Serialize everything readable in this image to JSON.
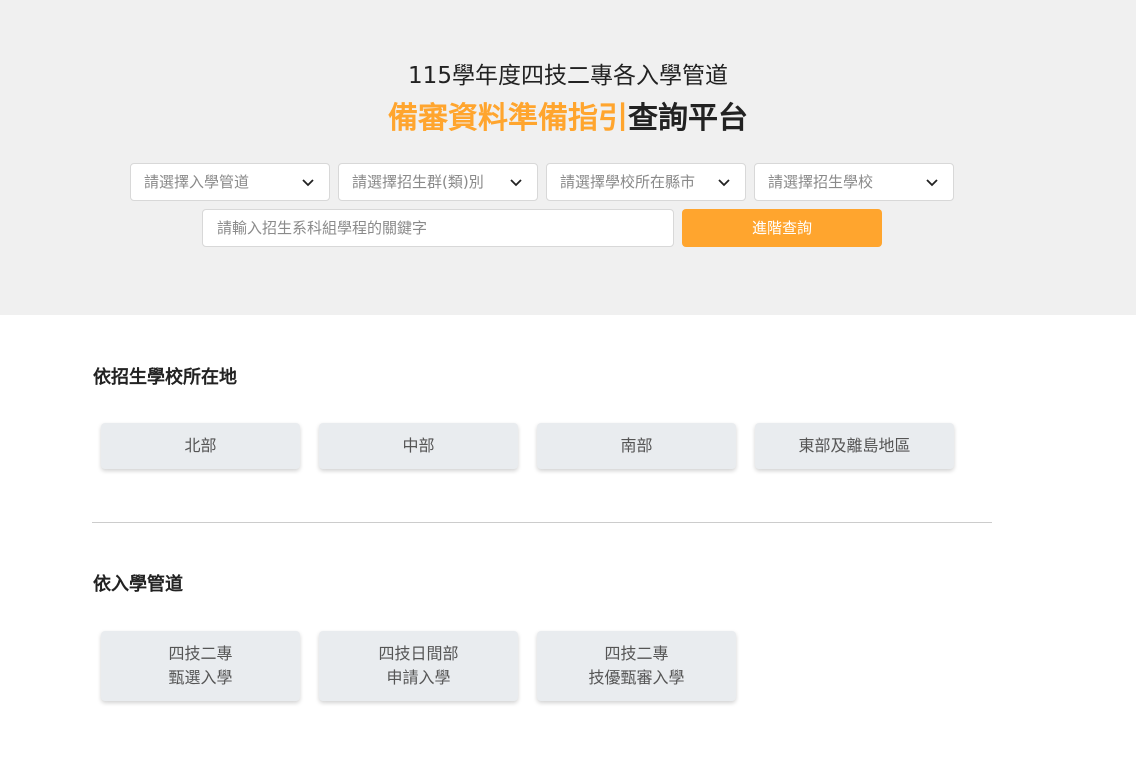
{
  "header": {
    "subtitle": "115學年度四技二專各入學管道",
    "title_accent": "備審資料準備指引",
    "title_rest": "查詢平台"
  },
  "filters": {
    "selects": [
      {
        "placeholder": "請選擇入學管道",
        "icon": "chevron-down-icon"
      },
      {
        "placeholder": "請選擇招生群(類)別",
        "icon": "chevron-down-icon"
      },
      {
        "placeholder": "請選擇學校所在縣市",
        "icon": "chevron-down-icon"
      },
      {
        "placeholder": "請選擇招生學校",
        "icon": "chevron-down-icon"
      }
    ],
    "keyword_placeholder": "請輸入招生系科組學程的關鍵字",
    "search_label": "進階查詢"
  },
  "by_location": {
    "title": "依招生學校所在地",
    "items": [
      "北部",
      "中部",
      "南部",
      "東部及離島地區"
    ]
  },
  "by_channel": {
    "title": "依入學管道",
    "items": [
      {
        "line1": "四技二專",
        "line2": "甄選入學"
      },
      {
        "line1": "四技日間部",
        "line2": "申請入學"
      },
      {
        "line1": "四技二專",
        "line2": "技優甄審入學"
      }
    ]
  },
  "colors": {
    "accent": "#ffa52e",
    "hero_bg": "#f0f0f0",
    "card_bg": "#e9ecef"
  }
}
